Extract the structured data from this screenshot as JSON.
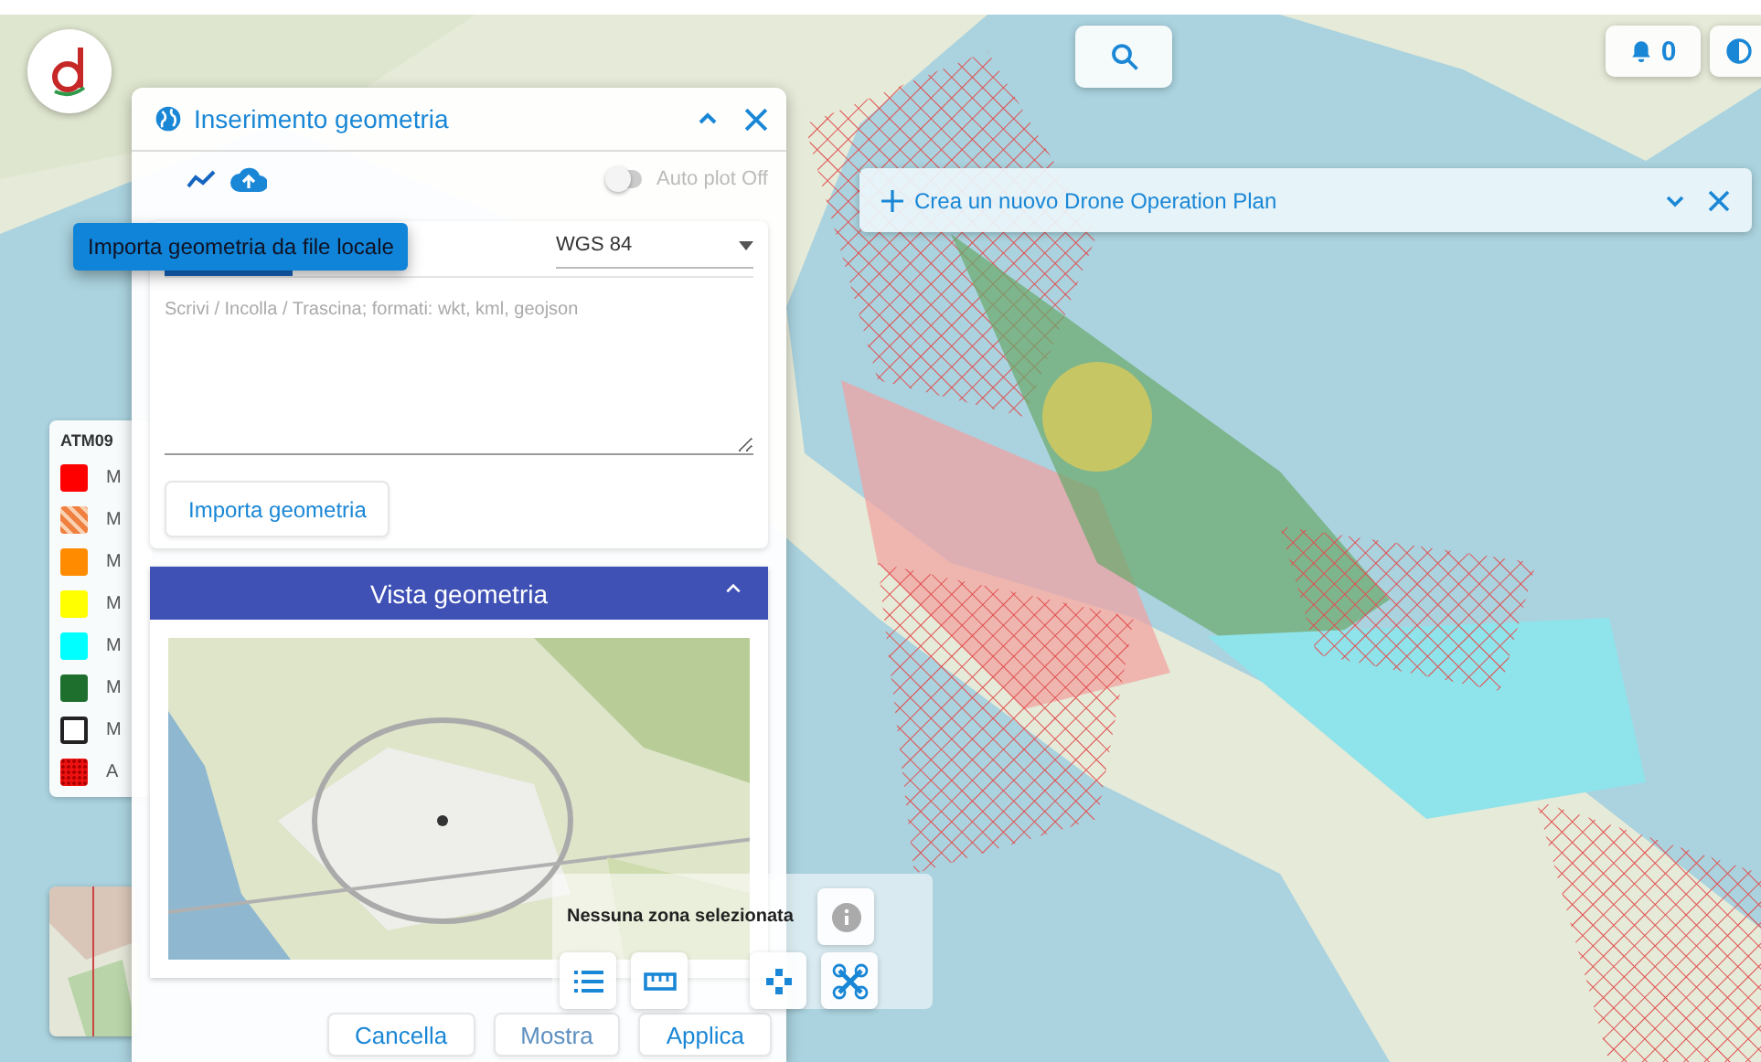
{
  "search_button": {
    "kind": "search"
  },
  "notifications": {
    "count": "0"
  },
  "dialog": {
    "title": "Inserimento geometria",
    "expanded": true,
    "toolbar": {
      "auto_plot": {
        "label": "Auto plot Off",
        "on": false
      }
    },
    "tooltip": "Importa geometria da file locale",
    "crs_select": {
      "value": "WGS 84"
    },
    "geometry_input": {
      "placeholder": "Scrivi / Incolla / Trascina; formati: wkt, kml, geojson"
    },
    "import_button": "Importa geometria",
    "preview": {
      "title": "Vista geometria",
      "expanded": true
    },
    "buttons": [
      {
        "label": "Cancella",
        "disabled": false
      },
      {
        "label": "Mostra",
        "disabled": true
      },
      {
        "label": "Applica",
        "disabled": false
      }
    ]
  },
  "legend": {
    "title": "ATM09",
    "items": [
      {
        "label": "M",
        "color": "#ff0000",
        "kind": "solid"
      },
      {
        "label": "M",
        "color": "#f08040",
        "kind": "hatched"
      },
      {
        "label": "M",
        "color": "#ff8c00",
        "kind": "solid"
      },
      {
        "label": "M",
        "color": "#ffff00",
        "kind": "solid"
      },
      {
        "label": "M",
        "color": "#00ffff",
        "kind": "solid"
      },
      {
        "label": "M",
        "color": "#1e6e2e",
        "kind": "solid"
      },
      {
        "label": "M",
        "color": "#222222",
        "kind": "outline"
      },
      {
        "label": "A",
        "color": "#ee1111",
        "kind": "dotted"
      }
    ]
  },
  "plan_bar": {
    "label": "Crea un nuovo Drone Operation Plan",
    "expanded": false
  },
  "zone_panel": {
    "status": "Nessuna zona selezionata"
  }
}
